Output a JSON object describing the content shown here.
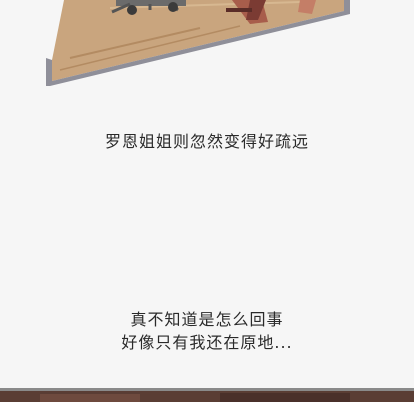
{
  "captions": [
    "罗恩姐姐则忽然变得好疏远",
    "真不知道是怎么回事",
    "好像只有我还在原地..."
  ],
  "colors": {
    "page_background": "#f6f6f6",
    "caption_text": "#2a2a2a",
    "floor_wood": "#c9a57e",
    "panel_border": "#8f8f99",
    "bottom_panel_dark": "#5a3d34"
  }
}
